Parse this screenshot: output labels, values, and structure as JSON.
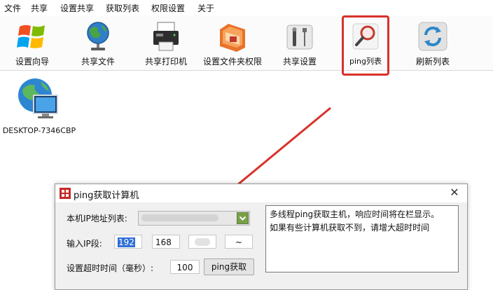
{
  "menu": [
    "文件",
    "共享",
    "设置共享",
    "获取列表",
    "权限设置",
    "关于"
  ],
  "toolbar": {
    "buttons": [
      {
        "label": "设置向导",
        "icon": "windows-logo-icon"
      },
      {
        "label": "共享文件",
        "icon": "globe-icon"
      },
      {
        "label": "共享打印机",
        "icon": "printer-icon"
      },
      {
        "label": "设置文件夹权限",
        "icon": "folder-lock-icon"
      },
      {
        "label": "共享设置",
        "icon": "tools-icon"
      },
      {
        "label": "ping列表",
        "icon": "magnifier-icon"
      },
      {
        "label": "刷新列表",
        "icon": "refresh-icon"
      }
    ],
    "highlighted": "ping列表",
    "highlight_color": "#d8312a"
  },
  "desktop": {
    "computer_name": "DESKTOP-7346CBP",
    "icon": "network-computer-icon"
  },
  "dialog": {
    "title": "ping获取计算机",
    "ip_list_label": "本机IP地址列表:",
    "ip_segment_label": "输入IP段:",
    "ip_segment": [
      "192",
      "168",
      "",
      "~"
    ],
    "timeout_label": "设置超时时间（毫秒）:",
    "timeout_value": "100",
    "ping_button": "ping获取",
    "info_lines": [
      "多线程ping获取主机，响应时间将在栏显示。",
      "如果有些计算机获取不到，请增大超时时间"
    ]
  }
}
